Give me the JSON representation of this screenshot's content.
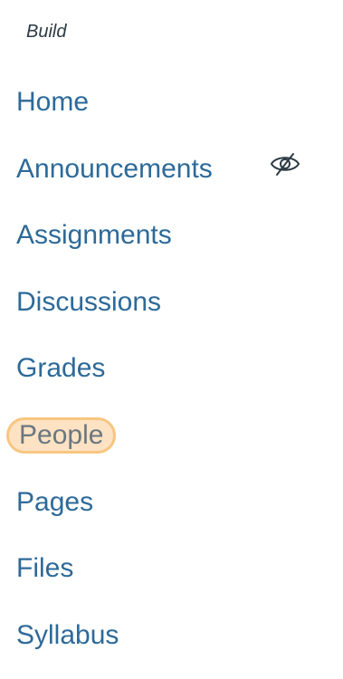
{
  "header": {
    "label": "Build"
  },
  "nav": {
    "items": [
      {
        "label": "Home"
      },
      {
        "label": "Announcements"
      },
      {
        "label": "Assignments"
      },
      {
        "label": "Discussions"
      },
      {
        "label": "Grades"
      },
      {
        "label": "People"
      },
      {
        "label": "Pages"
      },
      {
        "label": "Files"
      },
      {
        "label": "Syllabus"
      }
    ],
    "active_item": "People",
    "hidden_icon_on": "Announcements"
  },
  "colors": {
    "link": "#2d6a99",
    "text": "#2d3b45",
    "active_background": "#fde2c4",
    "active_border": "#f7c680",
    "active_text": "#6b7780"
  },
  "icons": {
    "visibility": "eye-slash-icon"
  }
}
